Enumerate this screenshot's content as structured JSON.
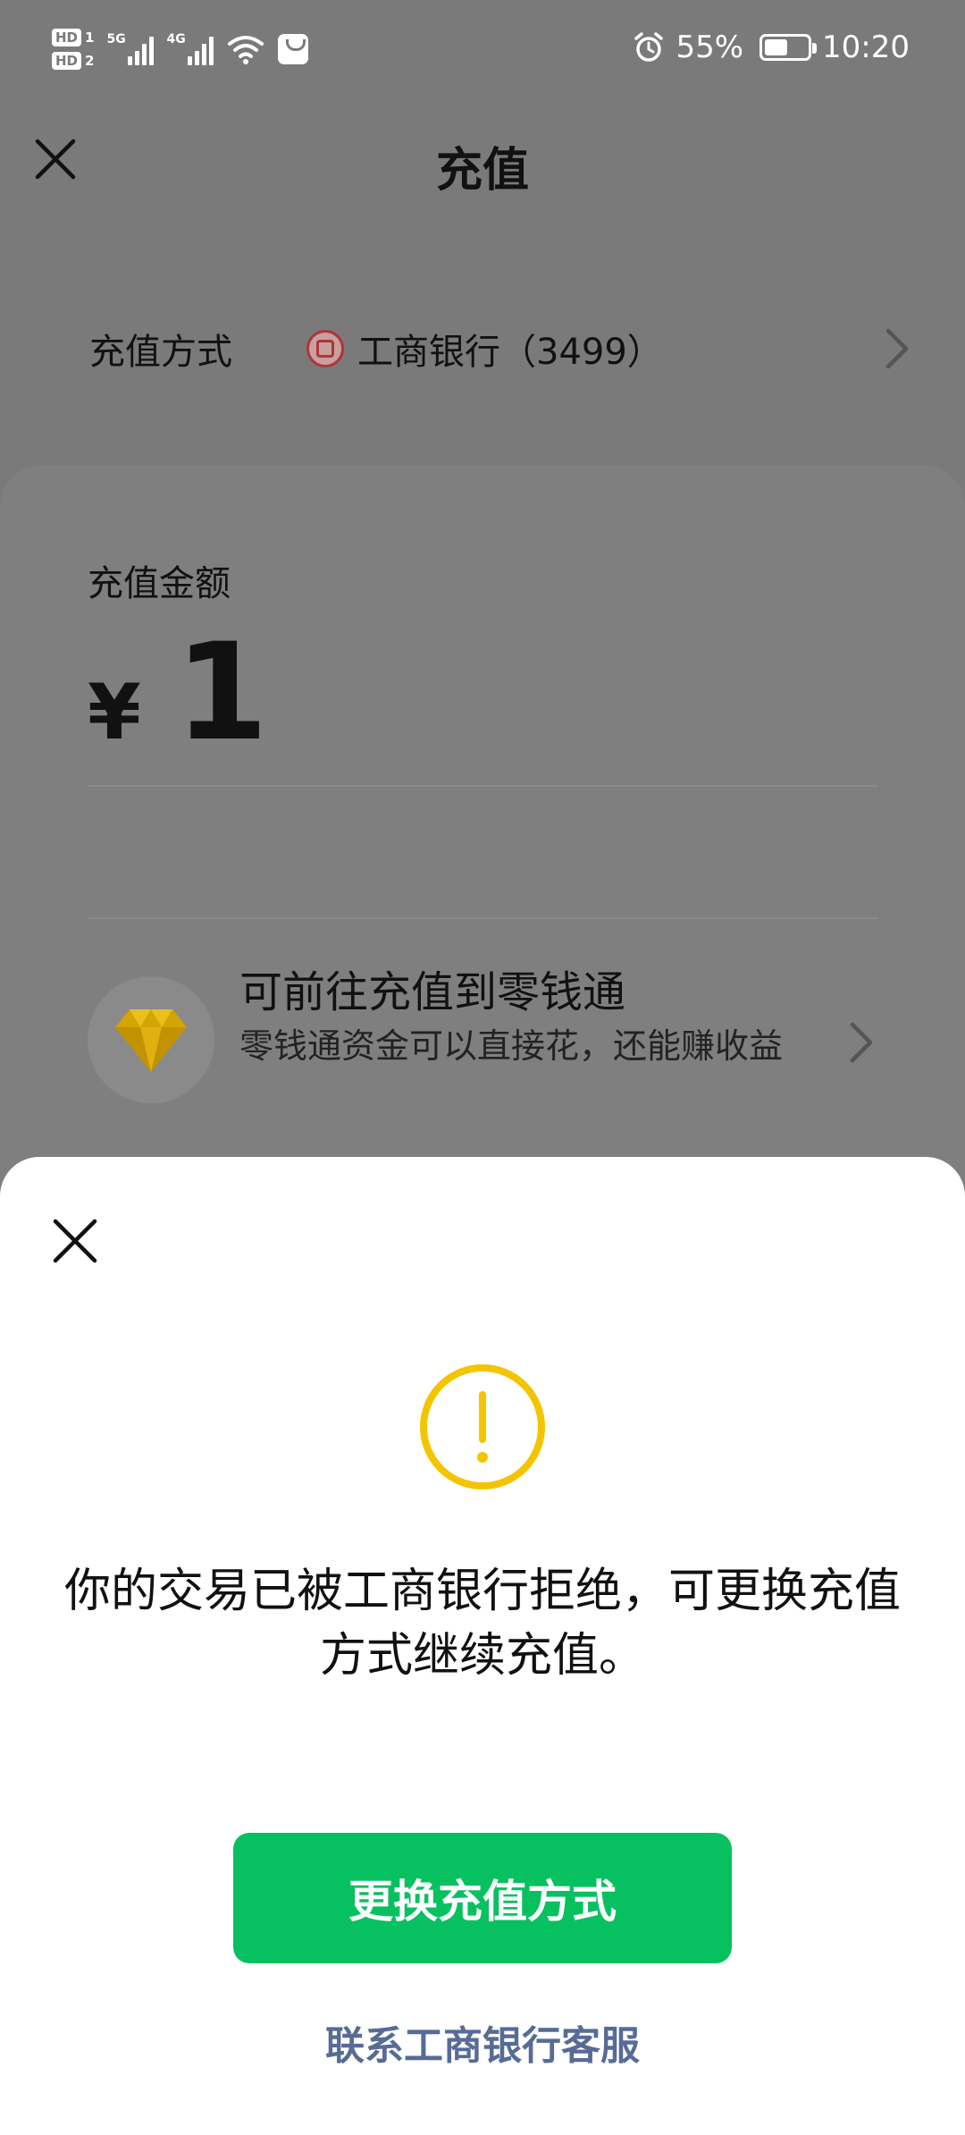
{
  "status_bar": {
    "hd1": "HD",
    "hd1_num": "1",
    "hd2": "HD",
    "hd2_num": "2",
    "network1": "5G",
    "network2": "4G",
    "battery_percent": "55%",
    "battery_level": 0.55,
    "time": "10:20",
    "icons": [
      "signal-icon",
      "wifi-icon",
      "shopping-bag-icon",
      "alarm-icon",
      "battery-icon"
    ]
  },
  "nav": {
    "title": "充值",
    "close_icon": "close-icon"
  },
  "recharge_method": {
    "label": "充值方式",
    "bank": "工商银行（3499）",
    "bank_icon": "icbc-bank-icon"
  },
  "amount": {
    "label": "充值金额",
    "currency": "¥",
    "value": "1"
  },
  "lingqiantong": {
    "title": "可前往充值到零钱通",
    "subtitle": "零钱通资金可以直接花，还能赚收益",
    "icon": "diamond-icon",
    "icon_color": "#d8a800"
  },
  "dialog": {
    "close_icon": "close-icon",
    "warning_icon": "warning-icon",
    "warning_color": "#f5c400",
    "message": "你的交易已被工商银行拒绝，可更换充值方式继续充值。",
    "primary_button": "更换充值方式",
    "primary_color": "#07c160",
    "link": "联系工商银行客服",
    "link_color": "#576b95"
  }
}
